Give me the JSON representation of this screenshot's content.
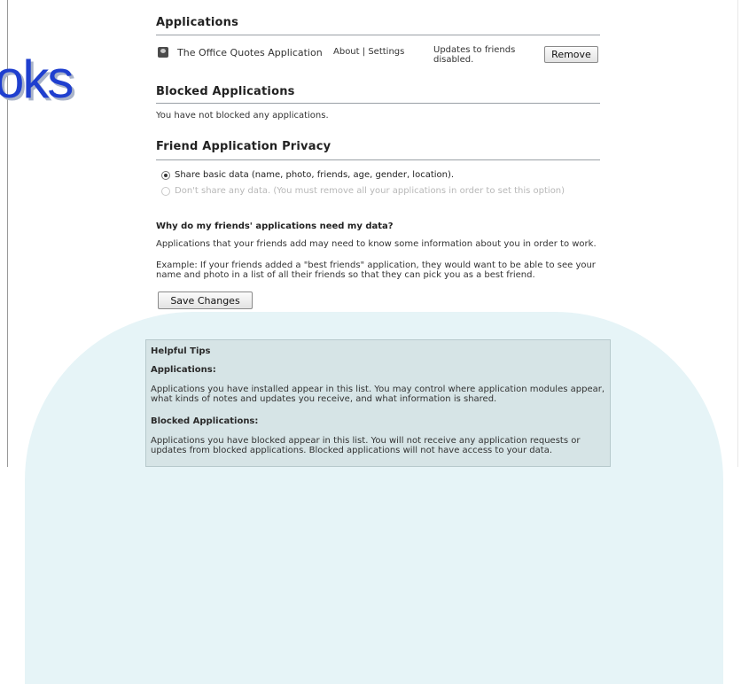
{
  "logo_text": "oks",
  "applications": {
    "title": "Applications",
    "rows": [
      {
        "icon": "app-avatar-icon",
        "name": "The Office Quotes Application",
        "about_link": "About",
        "separator": "|",
        "settings_link": "Settings",
        "status": "Updates to friends disabled.",
        "remove_label": "Remove"
      }
    ]
  },
  "blocked": {
    "title": "Blocked Applications",
    "message": "You have not blocked any applications."
  },
  "privacy": {
    "title": "Friend Application Privacy",
    "options": [
      {
        "label": "Share basic data (name, photo, friends, age, gender, location).",
        "checked": true,
        "disabled": false
      },
      {
        "label": "Don't share any data. (You must remove all your applications in order to set this option)",
        "checked": false,
        "disabled": true
      }
    ],
    "faq_question": "Why do my friends' applications need my data?",
    "faq_answer": "Applications that your friends add may need to know some information about you in order to work.",
    "faq_example": "Example: If your friends added a \"best friends\" application, they would want to be able to see your name and photo in a list of all their friends so that they can pick you as a best friend.",
    "save_label": "Save Changes"
  },
  "tips": {
    "title": "Helpful Tips",
    "applications_heading": "Applications:",
    "applications_text": "Applications you have installed appear in this list. You may control where application modules appear, what kinds of notes and updates you receive, and what information is shared.",
    "blocked_heading": "Blocked Applications:",
    "blocked_text": "Applications you have blocked appear in this list. You will not receive any application requests or updates from blocked applications. Blocked applications will not have access to your data."
  }
}
